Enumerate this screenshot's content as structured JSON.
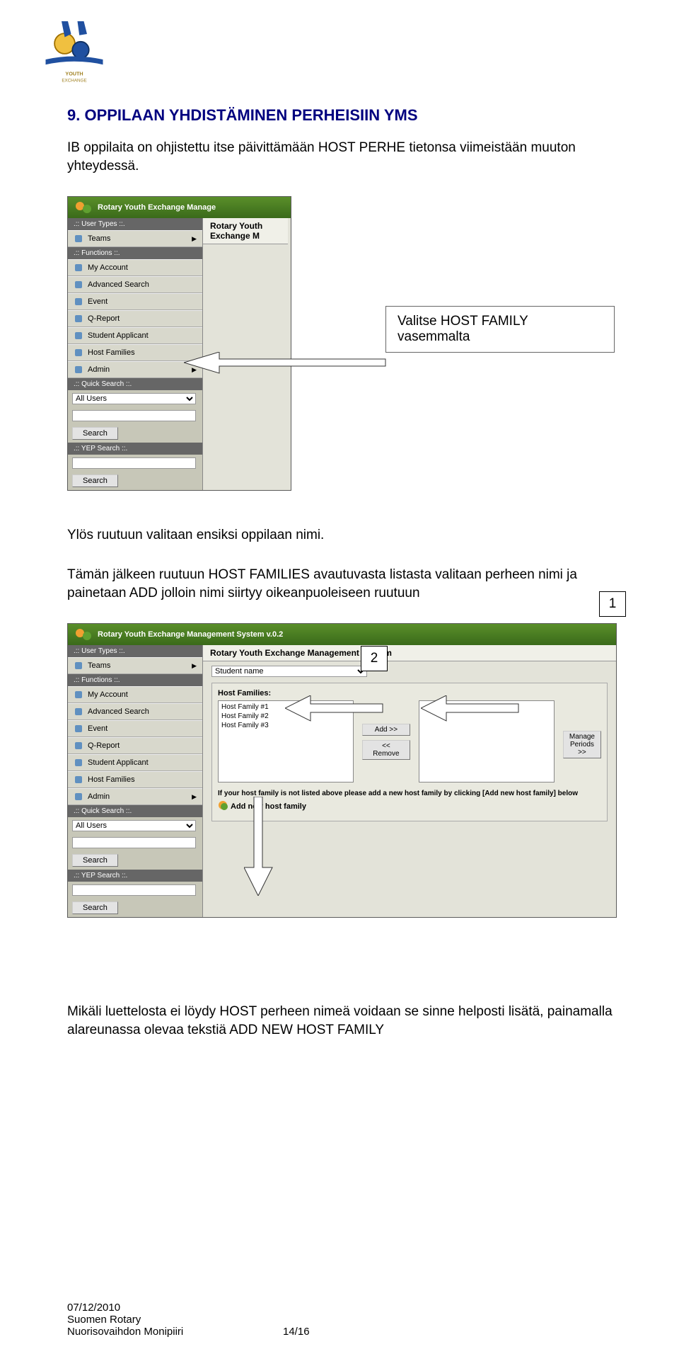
{
  "heading": "9. OPPILAAN YHDISTÄMINEN PERHEISIIN YMS",
  "intro": "IB oppilaita on ohjistettu itse päivittämään HOST PERHE tietonsa viimeistään muuton yhteydessä.",
  "callout1": "Valitse HOST FAMILY vasemmalta",
  "mid_p1": "Ylös ruutuun valitaan ensiksi oppilaan nimi.",
  "mid_p2": "Tämän jälkeen ruutuun HOST FAMILIES avautuvasta listasta valitaan perheen nimi ja painetaan ADD jolloin nimi siirtyy oikeanpuoleiseen ruutuun",
  "num1": "1",
  "num2": "2",
  "bottom": "Mikäli luettelosta ei löydy HOST perheen nimeä voidaan se sinne helposti lisätä, painamalla alareunassa olevaa tekstiä ADD NEW HOST FAMILY",
  "win1": {
    "title": "Rotary Youth Exchange Manage",
    "crumb": "Rotary Youth Exchange M",
    "sections": {
      "user_types": ".:: User Types ::.",
      "functions": ".:: Functions ::.",
      "quick": ".:: Quick Search ::.",
      "yep": ".:: YEP Search ::."
    },
    "items": {
      "teams": "Teams",
      "my_account": "My Account",
      "advanced": "Advanced Search",
      "event": "Event",
      "qreport": "Q-Report",
      "student": "Student Applicant",
      "host": "Host Families",
      "admin": "Admin"
    },
    "quick_select": "All Users",
    "search_btn": "Search"
  },
  "win2": {
    "title": "Rotary Youth Exchange Management System v.0.2",
    "crumb": "Rotary Youth Exchange Management System",
    "student_name": "Student name",
    "hf_label": "Host Families:",
    "hf_list": [
      "Host Family #1",
      "Host Family #2",
      "Host Family #3"
    ],
    "add_btn": "Add >>",
    "remove_btn": "<< Remove",
    "manage_btn": "Manage Periods >>",
    "hint": "If your host family is not listed above please add a new host family by clicking [Add new host family] below",
    "addnew": "Add new host family",
    "sections": {
      "user_types": ".:: User Types ::.",
      "functions": ".:: Functions ::.",
      "quick": ".:: Quick Search ::.",
      "yep": ".:: YEP Search ::."
    },
    "items": {
      "teams": "Teams",
      "my_account": "My Account",
      "advanced": "Advanced Search",
      "event": "Event",
      "qreport": "Q-Report",
      "student": "Student Applicant",
      "host": "Host Families",
      "admin": "Admin"
    },
    "quick_select": "All Users",
    "search_btn": "Search"
  },
  "footer_date": "07/12/2010",
  "footer_org1": "Suomen Rotary",
  "footer_org2": "Nuorisovaihdon Monipiiri",
  "page_num": "14/16"
}
